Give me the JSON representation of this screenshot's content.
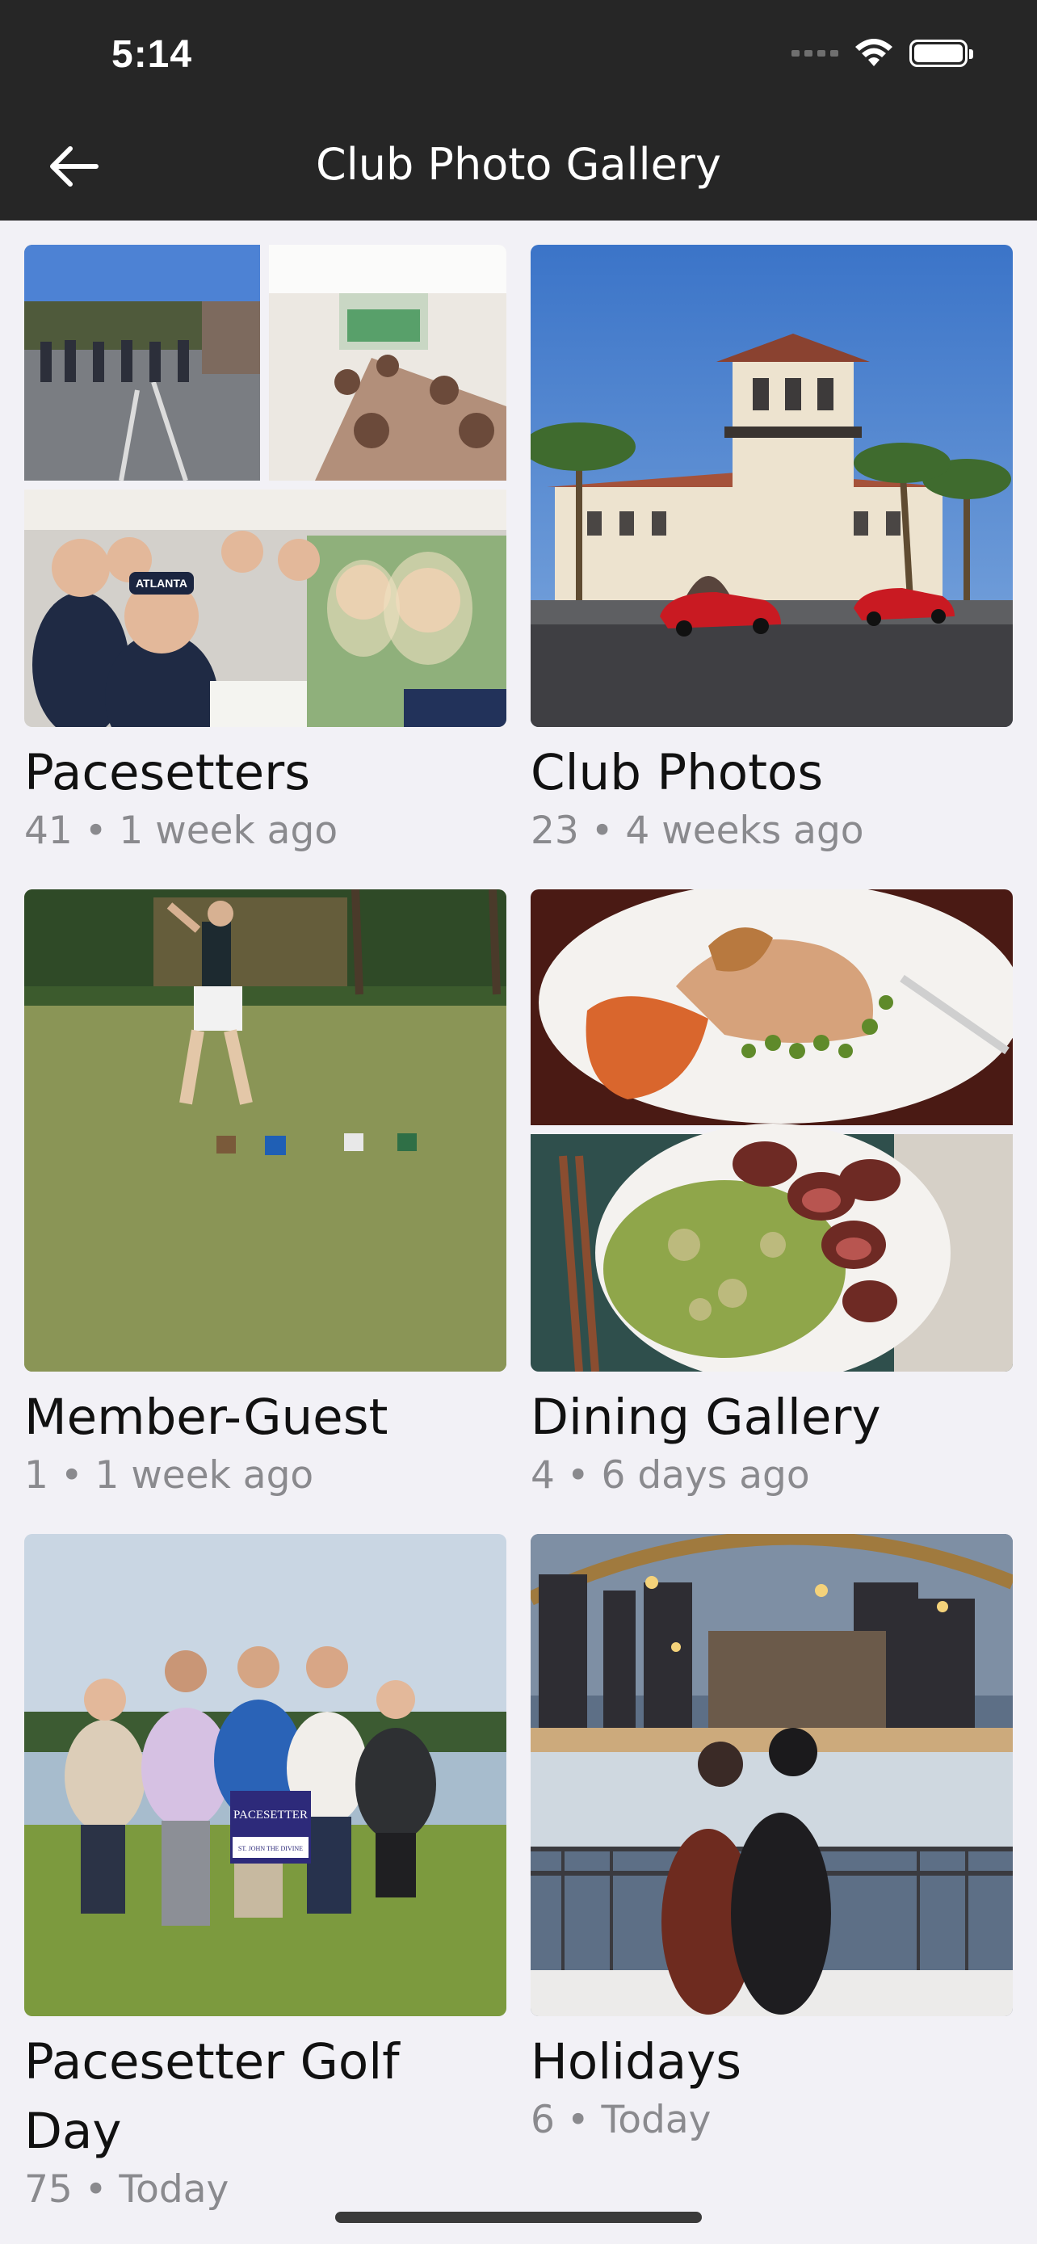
{
  "status_bar": {
    "time": "5:14"
  },
  "header": {
    "title": "Club Photo Gallery"
  },
  "albums": [
    {
      "title": "Pacesetters",
      "count": "41",
      "age": "1 week ago",
      "meta": "41 • 1 week ago"
    },
    {
      "title": "Club Photos",
      "count": "23",
      "age": "4 weeks ago",
      "meta": "23 • 4 weeks ago"
    },
    {
      "title": "Member-Guest",
      "count": "1",
      "age": "1 week ago",
      "meta": "1 • 1 week ago"
    },
    {
      "title": "Dining Gallery",
      "count": "4",
      "age": "6 days ago",
      "meta": "4 • 6 days ago"
    },
    {
      "title": "Pacesetter Golf Day",
      "count": "75",
      "age": "Today",
      "meta": "75 • Today"
    },
    {
      "title": "Holidays",
      "count": "6",
      "age": "Today",
      "meta": "6 • Today"
    }
  ],
  "photo_text": {
    "sign_main": "PACESETTER",
    "sign_sub": "ST. JOHN THE DIVINE",
    "cap_text": "ATLANTA"
  },
  "icons": {
    "back": "arrow-left-icon",
    "wifi": "wifi-icon",
    "battery": "battery-icon",
    "signal": "signal-icon"
  }
}
